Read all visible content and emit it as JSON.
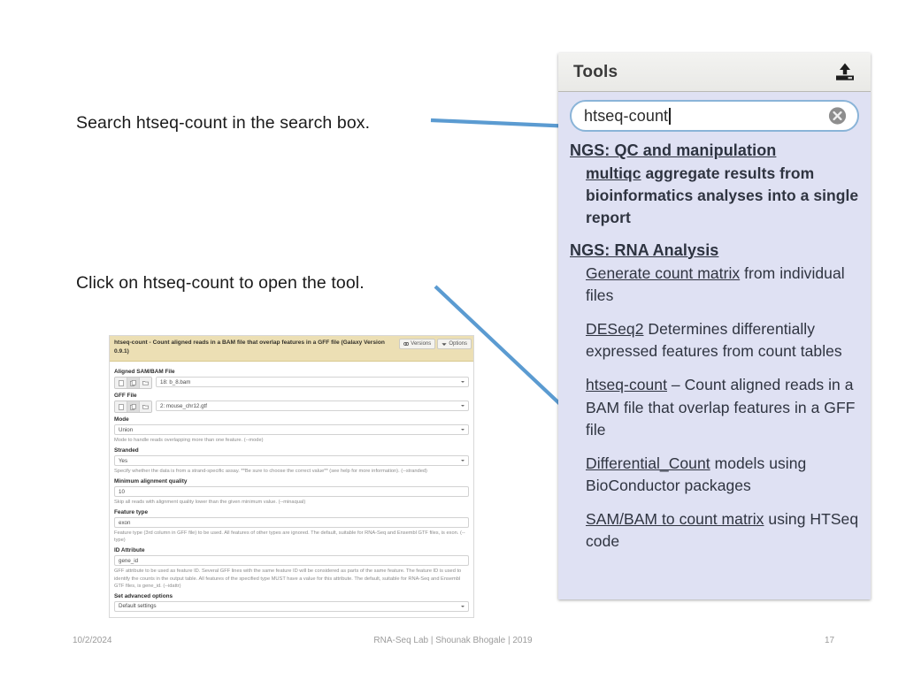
{
  "slide": {
    "callouts": [
      {
        "id": "search",
        "text": "Search htseq-count in the search box."
      },
      {
        "id": "click",
        "text": "Click on htseq-count to open the tool."
      }
    ],
    "arrow_color": "#5b9bd1"
  },
  "footer": {
    "date": "10/2/2024",
    "center": "RNA-Seq Lab  | Shounak Bhogale | 2019",
    "page": "17"
  },
  "tools_panel": {
    "title": "Tools",
    "upload_icon": "upload-icon",
    "search": {
      "value": "htseq-count",
      "placeholder": "search tools",
      "clear_icon": "clear-circle-icon"
    },
    "sections": [
      {
        "heading": "NGS: QC and manipulation",
        "tools": [
          {
            "name": "multiqc",
            "description": " aggregate results from bioinformatics analyses into a single report"
          }
        ]
      },
      {
        "heading": "NGS: RNA Analysis",
        "tools": [
          {
            "name": "Generate count matrix",
            "description": " from individual files"
          },
          {
            "name": "DESeq2",
            "description": " Determines differentially expressed features from count tables"
          },
          {
            "name": "htseq-count",
            "description": " – Count aligned reads in a BAM file that overlap features in a GFF file"
          },
          {
            "name": "Differential_Count",
            "description": " models using BioConductor packages"
          },
          {
            "name": "SAM/BAM to count matrix",
            "description": " using HTSeq code"
          }
        ]
      }
    ]
  },
  "tool_form": {
    "title": "htseq-count - Count aligned reads in a BAM file that overlap features in a GFF file (Galaxy Version 0.9.1)",
    "versions_label": "Versions",
    "options_label": "Options",
    "fields": [
      {
        "label": "Aligned SAM/BAM File",
        "kind": "dataset-select",
        "value": "18: b_8.bam",
        "help": ""
      },
      {
        "label": "GFF File",
        "kind": "dataset-select",
        "value": "2: mouse_chr12.gtf",
        "help": ""
      },
      {
        "label": "Mode",
        "kind": "select",
        "value": "Union",
        "help": "Mode to handle reads overlapping more than one feature. (--mode)"
      },
      {
        "label": "Stranded",
        "kind": "select",
        "value": "Yes",
        "help": "Specify whether the data is from a strand-specific assay. **Be sure to choose the correct value** (see help for more information). (--stranded)"
      },
      {
        "label": "Minimum alignment quality",
        "kind": "text",
        "value": "10",
        "help": "Skip all reads with alignment quality lower than the given minimum value. (--minaqual)"
      },
      {
        "label": "Feature type",
        "kind": "text",
        "value": "exon",
        "help": "Feature type (3rd column in GFF file) to be used. All features of other types are ignored. The default, suitable for RNA-Seq and Ensembl GTF files, is exon. (--type)"
      },
      {
        "label": "ID Attribute",
        "kind": "text",
        "value": "gene_id",
        "help": "GFF attribute to be used as feature ID. Several GFF lines with the same feature ID will be considered as parts of the same feature. The feature ID is used to identify the counts in the output table. All features of the specified type MUST have a value for this attribute. The default, suitable for RNA-Seq and Ensembl GTF files, is gene_id. (--idattr)"
      },
      {
        "label": "Set advanced options",
        "kind": "select",
        "value": "Default settings",
        "help": ""
      }
    ]
  }
}
